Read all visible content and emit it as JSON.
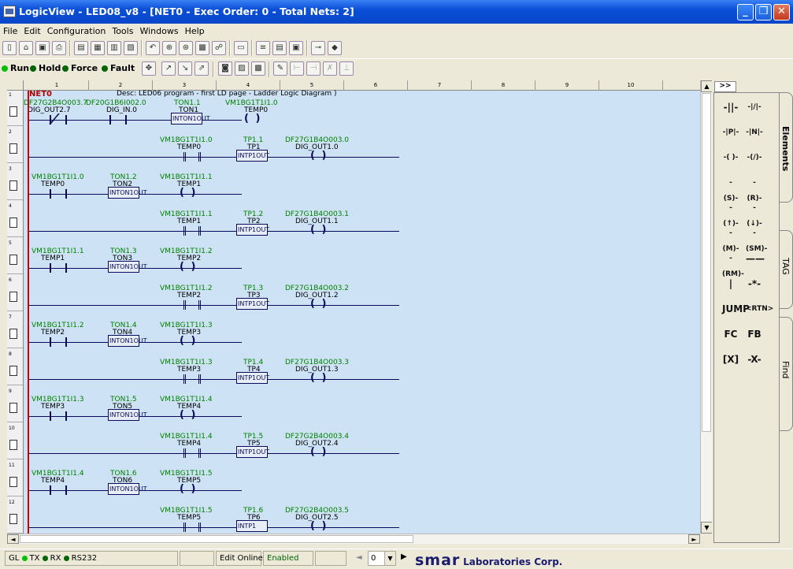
{
  "window": {
    "title": "LogicView - LED08_v8 - [NET0 - Exec Order: 0 - Total Nets: 2]"
  },
  "menu": [
    "File",
    "Edit",
    "Configuration",
    "Tools",
    "Windows",
    "Help"
  ],
  "runbar": {
    "run": "Run",
    "hold": "Hold",
    "force": "Force",
    "fault": "Fault",
    "run_color": "#00c000",
    "hold_color": "#006400",
    "force_color": "#006400",
    "fault_color": "#006400"
  },
  "ruler": [
    "1",
    "2",
    "3",
    "4",
    "5",
    "6",
    "7",
    "8",
    "9",
    "10"
  ],
  "rows": [
    "1",
    "2",
    "3",
    "4",
    "5",
    "6",
    "7",
    "8",
    "9",
    "10",
    "11",
    "12"
  ],
  "net": {
    "name": "NET0",
    "desc": "Desc: LED06 program - first LD page - Ladder Logic Diagram                )"
  },
  "rungs": [
    {
      "c1tag": "DF27G2B4O003.7",
      "c1n": "DIG_OUT2.7",
      "c2tag": "DF20G1B6I002.0",
      "c2n": "DIG_IN.0",
      "fbtag": "TON1.1",
      "fbn": "TON1",
      "fbtext": "INTON1OUT",
      "coiltag": "VM1BG1T1I1.0",
      "coiln": "TEMP0"
    },
    {
      "c1tag": "VM1BG1T1I1.0",
      "c1n": "TEMP0",
      "fbtag": "TP1.1",
      "fbn": "TP1",
      "fbtext": "INTP1OUT",
      "coiltag": "DF27G1B4O003.0",
      "coiln": "DIG_OUT1.0"
    },
    {
      "c1tag": "VM1BG1T1I1.0",
      "c1n": "TEMP0",
      "fbtag": "TON1.2",
      "fbn": "TON2",
      "fbtext": "INTON1OUT",
      "coiltag": "VM1BG1T1I1.1",
      "coiln": "TEMP1"
    },
    {
      "c1tag": "VM1BG1T1I1.1",
      "c1n": "TEMP1",
      "fbtag": "TP1.2",
      "fbn": "TP2",
      "fbtext": "INTP1OUT",
      "coiltag": "DF27G1B4O003.1",
      "coiln": "DIG_OUT1.1"
    },
    {
      "c1tag": "VM1BG1T1I1.1",
      "c1n": "TEMP1",
      "fbtag": "TON1.3",
      "fbn": "TON3",
      "fbtext": "INTON1OUT",
      "coiltag": "VM1BG1T1I1.2",
      "coiln": "TEMP2"
    },
    {
      "c1tag": "VM1BG1T1I1.2",
      "c1n": "TEMP2",
      "fbtag": "TP1.3",
      "fbn": "TP3",
      "fbtext": "INTP1OUT",
      "coiltag": "DF27G1B4O003.2",
      "coiln": "DIG_OUT1.2"
    },
    {
      "c1tag": "VM1BG1T1I1.2",
      "c1n": "TEMP2",
      "fbtag": "TON1.4",
      "fbn": "TON4",
      "fbtext": "INTON1OUT",
      "coiltag": "VM1BG1T1I1.3",
      "coiln": "TEMP3"
    },
    {
      "c1tag": "VM1BG1T1I1.3",
      "c1n": "TEMP3",
      "fbtag": "TP1.4",
      "fbn": "TP4",
      "fbtext": "INTP1OUT",
      "coiltag": "DF27G1B4O003.3",
      "coiln": "DIG_OUT1.3"
    },
    {
      "c1tag": "VM1BG1T1I1.3",
      "c1n": "TEMP3",
      "fbtag": "TON1.5",
      "fbn": "TON5",
      "fbtext": "INTON1OUT",
      "coiltag": "VM1BG1T1I1.4",
      "coiln": "TEMP4"
    },
    {
      "c1tag": "VM1BG1T1I1.4",
      "c1n": "TEMP4",
      "fbtag": "TP1.5",
      "fbn": "TP5",
      "fbtext": "INTP1OUT",
      "coiltag": "DF27G2B4O003.4",
      "coiln": "DIG_OUT2.4"
    },
    {
      "c1tag": "VM1BG1T1I1.4",
      "c1n": "TEMP4",
      "fbtag": "TON1.6",
      "fbn": "TON6",
      "fbtext": "INTON1OUT",
      "coiltag": "VM1BG1T1I1.5",
      "coiln": "TEMP5"
    },
    {
      "c1tag": "VM1BG1T1I1.5",
      "c1n": "TEMP5",
      "fbtag": "TP1.6",
      "fbn": "TP6",
      "fbtext": "INTP1",
      "coiltag": "DF27G2B4O003.5",
      "coiln": "DIG_OUT2.5"
    }
  ],
  "panel": {
    "top_tab": ">>",
    "tabs": [
      "Elements",
      "TAG",
      "Find"
    ],
    "elements": [
      "-||-",
      "-|/|-",
      "-|P|-",
      "-|N|-",
      "-( )-",
      "-(/)-",
      "-(S)-",
      "-(R)-",
      "-(↑)-",
      "-(↓)-",
      "-(M)-",
      "-(SM)-",
      "-(RM)-",
      "——",
      "|",
      "-*-",
      "JUMP",
      "<RTN>",
      "FC",
      "FB",
      "[X]",
      "-X-"
    ]
  },
  "status": {
    "gl": "GL",
    "tx": "TX",
    "rx": "RX",
    "port": "RS232",
    "mode": "Edit Online",
    "state": "Enabled",
    "page": "0",
    "logo": "smar",
    "company": "Laboratories Corp.",
    "gl_color": "#00c000",
    "dot_color": "#006400"
  }
}
